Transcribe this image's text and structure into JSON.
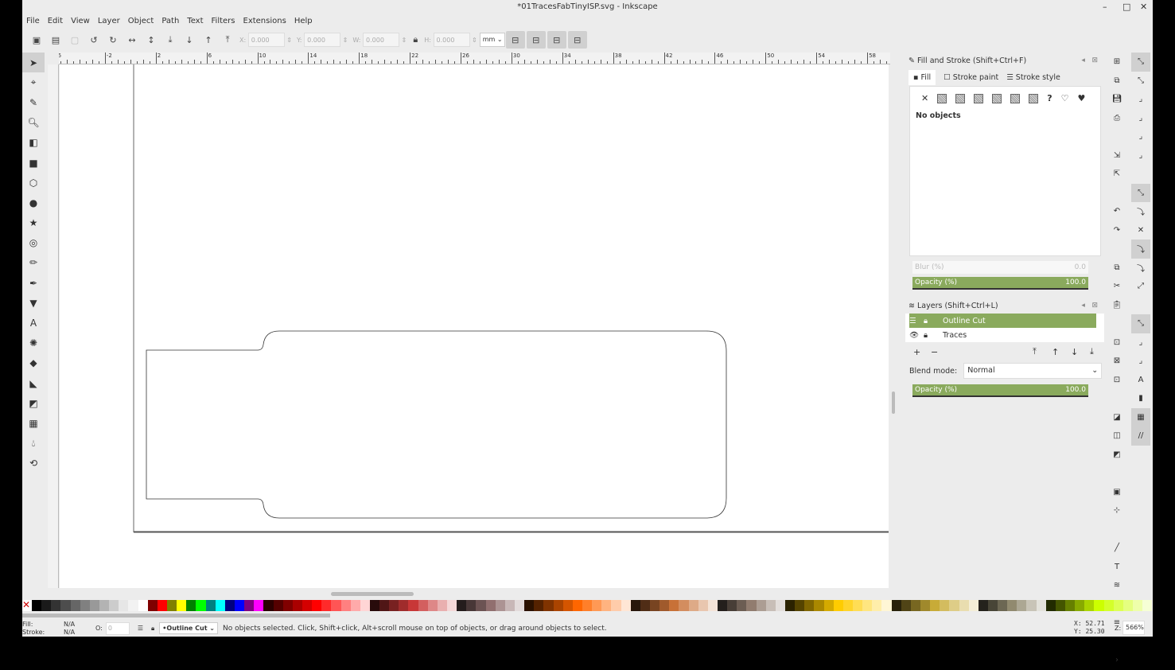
{
  "window": {
    "title": "*01TracesFabTinyISP.svg - Inkscape",
    "minimize": "–",
    "maximize": "□",
    "close": "✕"
  },
  "menu": [
    "File",
    "Edit",
    "View",
    "Layer",
    "Object",
    "Path",
    "Text",
    "Filters",
    "Extensions",
    "Help"
  ],
  "toolbar": {
    "x_label": "X:",
    "x": "0.000",
    "y_label": "Y:",
    "y": "0.000",
    "w_label": "W:",
    "w": "0.000",
    "h_label": "H:",
    "h": "0.000",
    "unit": "mm"
  },
  "ruler": {
    "top_labels": [
      "-6",
      "-2",
      "2",
      "6",
      "10",
      "14",
      "18",
      "22",
      "26",
      "30",
      "34",
      "38",
      "42",
      "46",
      "50",
      "54",
      "58"
    ]
  },
  "fill_stroke": {
    "title": "Fill and Stroke (Shift+Ctrl+F)",
    "tabs": [
      "Fill",
      "Stroke paint",
      "Stroke style"
    ],
    "message": "No objects",
    "blur_label": "Blur (%)",
    "blur": "0.0",
    "opacity_label": "Opacity (%)",
    "opacity": "100.0"
  },
  "layers": {
    "title": "Layers (Shift+Ctrl+L)",
    "items": [
      {
        "name": "Outline Cut",
        "selected": true
      },
      {
        "name": "Traces",
        "selected": false
      }
    ],
    "blend_label": "Blend mode:",
    "blend": "Normal",
    "opacity_label": "Opacity (%)",
    "opacity": "100.0"
  },
  "palette": [
    "#000000",
    "#1a1a1a",
    "#333333",
    "#4d4d4d",
    "#666666",
    "#808080",
    "#999999",
    "#b3b3b3",
    "#cccccc",
    "#e6e6e6",
    "#f2f2f2",
    "#ffffff",
    "#800000",
    "#ff0000",
    "#808000",
    "#ffff00",
    "#008000",
    "#00ff00",
    "#008080",
    "#00ffff",
    "#000080",
    "#0000ff",
    "#800080",
    "#ff00ff",
    "#2b0000",
    "#550000",
    "#800000",
    "#aa0000",
    "#d40000",
    "#ff0000",
    "#ff2a2a",
    "#ff5555",
    "#ff8080",
    "#ffaaaa",
    "#ffd5d5",
    "#280b0b",
    "#501616",
    "#782121",
    "#a02c2c",
    "#c83737",
    "#d35f5f",
    "#de8787",
    "#e9afaf",
    "#f4d7d7",
    "#241c1c",
    "#483737",
    "#6c5353",
    "#916f6f",
    "#ac9393",
    "#c8b7b7",
    "#e3dbdb",
    "#2b1100",
    "#552200",
    "#803300",
    "#aa4400",
    "#d45500",
    "#ff6600",
    "#ff7f2a",
    "#ff9955",
    "#ffb380",
    "#ffccaa",
    "#ffe6d5",
    "#28170b",
    "#502d16",
    "#784421",
    "#a05a2c",
    "#c87137",
    "#d38d5f",
    "#deaa87",
    "#e9c6af",
    "#f4e3d7",
    "#241f1c",
    "#483e37",
    "#6c5d53",
    "#917c6f",
    "#ac9d93",
    "#c8beb7",
    "#e3dedb",
    "#2b2200",
    "#554400",
    "#806600",
    "#aa8800",
    "#d4aa00",
    "#ffcc00",
    "#ffd42a",
    "#ffdd55",
    "#ffe680",
    "#ffeeaa",
    "#fff6d5",
    "#28220b",
    "#504416",
    "#786721",
    "#a0892c",
    "#c8ab37",
    "#d3bc5f",
    "#decd87",
    "#e9ddaf",
    "#f4eed7",
    "#24221c",
    "#484537",
    "#6c6753",
    "#918a6f",
    "#aca793",
    "#c8c4b7",
    "#e3e2db",
    "#222b00",
    "#445500",
    "#668000",
    "#88aa00",
    "#aad400",
    "#ccff00",
    "#d4ff2a",
    "#ddff55",
    "#e5ff80",
    "#eeffaa",
    "#f6ffd5"
  ],
  "status": {
    "fill_label": "Fill:",
    "fill": "N/A",
    "stroke_label": "Stroke:",
    "stroke": "N/A",
    "o_label": "O:",
    "o": "0",
    "layer": "•Outline Cut",
    "message": "No objects selected. Click, Shift+click, Alt+scroll mouse on top of objects, or drag around objects to select.",
    "x_label": "X:",
    "x": "52.71",
    "y_label": "Y:",
    "y": "25.30",
    "z_label": "Z:",
    "zoom": "566%"
  }
}
